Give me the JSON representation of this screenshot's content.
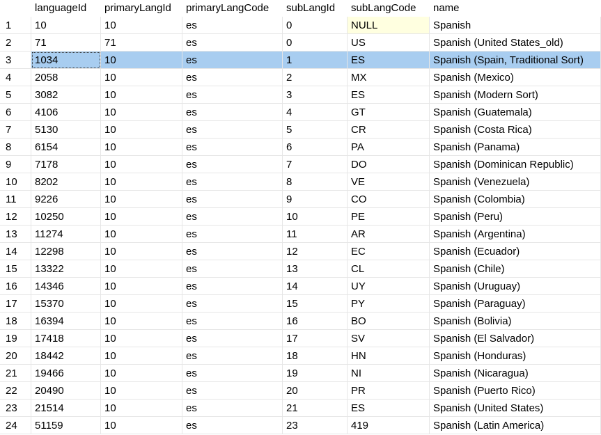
{
  "columns": [
    "",
    "languageId",
    "primaryLangId",
    "primaryLangCode",
    "subLangId",
    "subLangCode",
    "name"
  ],
  "selected_row": 3,
  "rows": [
    {
      "n": "1",
      "languageId": "10",
      "primaryLangId": "10",
      "primaryLangCode": "es",
      "subLangId": "0",
      "subLangCode": "NULL",
      "name": "Spanish"
    },
    {
      "n": "2",
      "languageId": "71",
      "primaryLangId": "71",
      "primaryLangCode": "es",
      "subLangId": "0",
      "subLangCode": "US",
      "name": "Spanish (United States_old)"
    },
    {
      "n": "3",
      "languageId": "1034",
      "primaryLangId": "10",
      "primaryLangCode": "es",
      "subLangId": "1",
      "subLangCode": "ES",
      "name": "Spanish (Spain, Traditional Sort)"
    },
    {
      "n": "4",
      "languageId": "2058",
      "primaryLangId": "10",
      "primaryLangCode": "es",
      "subLangId": "2",
      "subLangCode": "MX",
      "name": "Spanish (Mexico)"
    },
    {
      "n": "5",
      "languageId": "3082",
      "primaryLangId": "10",
      "primaryLangCode": "es",
      "subLangId": "3",
      "subLangCode": "ES",
      "name": "Spanish (Modern Sort)"
    },
    {
      "n": "6",
      "languageId": "4106",
      "primaryLangId": "10",
      "primaryLangCode": "es",
      "subLangId": "4",
      "subLangCode": "GT",
      "name": "Spanish (Guatemala)"
    },
    {
      "n": "7",
      "languageId": "5130",
      "primaryLangId": "10",
      "primaryLangCode": "es",
      "subLangId": "5",
      "subLangCode": "CR",
      "name": "Spanish (Costa Rica)"
    },
    {
      "n": "8",
      "languageId": "6154",
      "primaryLangId": "10",
      "primaryLangCode": "es",
      "subLangId": "6",
      "subLangCode": "PA",
      "name": "Spanish (Panama)"
    },
    {
      "n": "9",
      "languageId": "7178",
      "primaryLangId": "10",
      "primaryLangCode": "es",
      "subLangId": "7",
      "subLangCode": "DO",
      "name": "Spanish (Dominican Republic)"
    },
    {
      "n": "10",
      "languageId": "8202",
      "primaryLangId": "10",
      "primaryLangCode": "es",
      "subLangId": "8",
      "subLangCode": "VE",
      "name": "Spanish (Venezuela)"
    },
    {
      "n": "11",
      "languageId": "9226",
      "primaryLangId": "10",
      "primaryLangCode": "es",
      "subLangId": "9",
      "subLangCode": "CO",
      "name": "Spanish (Colombia)"
    },
    {
      "n": "12",
      "languageId": "10250",
      "primaryLangId": "10",
      "primaryLangCode": "es",
      "subLangId": "10",
      "subLangCode": "PE",
      "name": "Spanish (Peru)"
    },
    {
      "n": "13",
      "languageId": "11274",
      "primaryLangId": "10",
      "primaryLangCode": "es",
      "subLangId": "11",
      "subLangCode": "AR",
      "name": "Spanish (Argentina)"
    },
    {
      "n": "14",
      "languageId": "12298",
      "primaryLangId": "10",
      "primaryLangCode": "es",
      "subLangId": "12",
      "subLangCode": "EC",
      "name": "Spanish (Ecuador)"
    },
    {
      "n": "15",
      "languageId": "13322",
      "primaryLangId": "10",
      "primaryLangCode": "es",
      "subLangId": "13",
      "subLangCode": "CL",
      "name": "Spanish (Chile)"
    },
    {
      "n": "16",
      "languageId": "14346",
      "primaryLangId": "10",
      "primaryLangCode": "es",
      "subLangId": "14",
      "subLangCode": "UY",
      "name": "Spanish (Uruguay)"
    },
    {
      "n": "17",
      "languageId": "15370",
      "primaryLangId": "10",
      "primaryLangCode": "es",
      "subLangId": "15",
      "subLangCode": "PY",
      "name": "Spanish (Paraguay)"
    },
    {
      "n": "18",
      "languageId": "16394",
      "primaryLangId": "10",
      "primaryLangCode": "es",
      "subLangId": "16",
      "subLangCode": "BO",
      "name": "Spanish (Bolivia)"
    },
    {
      "n": "19",
      "languageId": "17418",
      "primaryLangId": "10",
      "primaryLangCode": "es",
      "subLangId": "17",
      "subLangCode": "SV",
      "name": "Spanish (El Salvador)"
    },
    {
      "n": "20",
      "languageId": "18442",
      "primaryLangId": "10",
      "primaryLangCode": "es",
      "subLangId": "18",
      "subLangCode": "HN",
      "name": "Spanish (Honduras)"
    },
    {
      "n": "21",
      "languageId": "19466",
      "primaryLangId": "10",
      "primaryLangCode": "es",
      "subLangId": "19",
      "subLangCode": "NI",
      "name": "Spanish (Nicaragua)"
    },
    {
      "n": "22",
      "languageId": "20490",
      "primaryLangId": "10",
      "primaryLangCode": "es",
      "subLangId": "20",
      "subLangCode": "PR",
      "name": "Spanish (Puerto Rico)"
    },
    {
      "n": "23",
      "languageId": "21514",
      "primaryLangId": "10",
      "primaryLangCode": "es",
      "subLangId": "21",
      "subLangCode": "ES",
      "name": "Spanish (United States)"
    },
    {
      "n": "24",
      "languageId": "51159",
      "primaryLangId": "10",
      "primaryLangCode": "es",
      "subLangId": "23",
      "subLangCode": "419",
      "name": "Spanish (Latin America)"
    }
  ]
}
